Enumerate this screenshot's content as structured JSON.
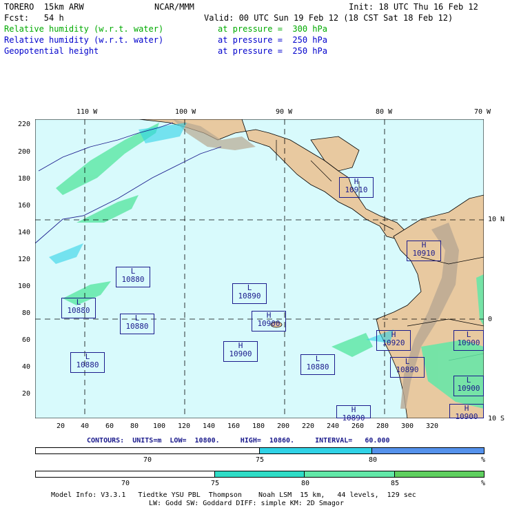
{
  "header": {
    "model": "TORERO  15km ARW",
    "org": "NCAR/MMM",
    "init": "Init: 18 UTC Thu 16 Feb 12",
    "fcst": "Fcst:   54 h",
    "valid": "Valid: 00 UTC Sun 19 Feb 12 (18 CST Sat 18 Feb 12)",
    "fields": [
      {
        "name": "Relative humidity (w.r.t. water)",
        "level": "at pressure =  300 hPa",
        "color": "#00aa00"
      },
      {
        "name": "Relative humidity (w.r.t. water)",
        "level": "at pressure =  250 hPa",
        "color": "#0000cc"
      },
      {
        "name": "Geopotential height",
        "level": "at pressure =  250 hPa",
        "color": "#0000cc"
      }
    ]
  },
  "map": {
    "top_lon_labels": [
      "110 W",
      "100 W",
      "90 W",
      "80 W",
      "70 W"
    ],
    "right_lat_labels": [
      "10 N",
      "0",
      "10 S"
    ],
    "left_y_ticks": [
      "220",
      "200",
      "180",
      "160",
      "140",
      "120",
      "100",
      "80",
      "60",
      "40",
      "20"
    ],
    "bottom_x_ticks": [
      "20",
      "40",
      "60",
      "80",
      "100",
      "120",
      "140",
      "160",
      "180",
      "200",
      "220",
      "240",
      "260",
      "280",
      "300",
      "320"
    ],
    "ocean_color": "#d8fafc",
    "land_color": "#e8c9a0",
    "highs_lows": [
      {
        "type": "H",
        "value": "10910",
        "pos": "gulf"
      },
      {
        "type": "H",
        "value": "10910",
        "pos": "colombia"
      },
      {
        "type": "L",
        "value": "10880",
        "pos": "w1"
      },
      {
        "type": "L",
        "value": "10880",
        "pos": "w2"
      },
      {
        "type": "L",
        "value": "10880",
        "pos": "w3"
      },
      {
        "type": "L",
        "value": "10880",
        "pos": "w4"
      },
      {
        "type": "L",
        "value": "10890",
        "pos": "c1"
      },
      {
        "type": "H",
        "value": "10900",
        "pos": "galap"
      },
      {
        "type": "H",
        "value": "10900",
        "pos": "c2"
      },
      {
        "type": "L",
        "value": "10880",
        "pos": "c3"
      },
      {
        "type": "H",
        "value": "10920",
        "pos": "ecuador"
      },
      {
        "type": "L",
        "value": "10890",
        "pos": "peru"
      },
      {
        "type": "L",
        "value": "10900",
        "pos": "e1"
      },
      {
        "type": "L",
        "value": "10900",
        "pos": "e2"
      },
      {
        "type": "H",
        "value": "10900",
        "pos": "e3"
      },
      {
        "type": "H",
        "value": "10890",
        "pos": "s1"
      }
    ]
  },
  "contours": "CONTOURS:  UNITS=m  LOW=  10800.     HIGH=  10860.     INTERVAL=   60.000",
  "colorbar1": {
    "labels": [
      "70",
      "75",
      "80",
      "%"
    ],
    "colors": [
      "#ffffff",
      "#30d2e6",
      "#5592ec"
    ]
  },
  "colorbar2": {
    "labels": [
      "70",
      "75",
      "80",
      "85",
      "%"
    ],
    "colors": [
      "#ffffff",
      "#2fdcc6",
      "#62e8a8",
      "#5fcf5f"
    ]
  },
  "model_info": [
    "Model Info: V3.3.1   Tiedtke YSU PBL  Thompson    Noah LSM  15 km,   44 levels,  129 sec",
    "LW: Godd SW: Goddard DIFF: simple KM: 2D Smagor"
  ]
}
